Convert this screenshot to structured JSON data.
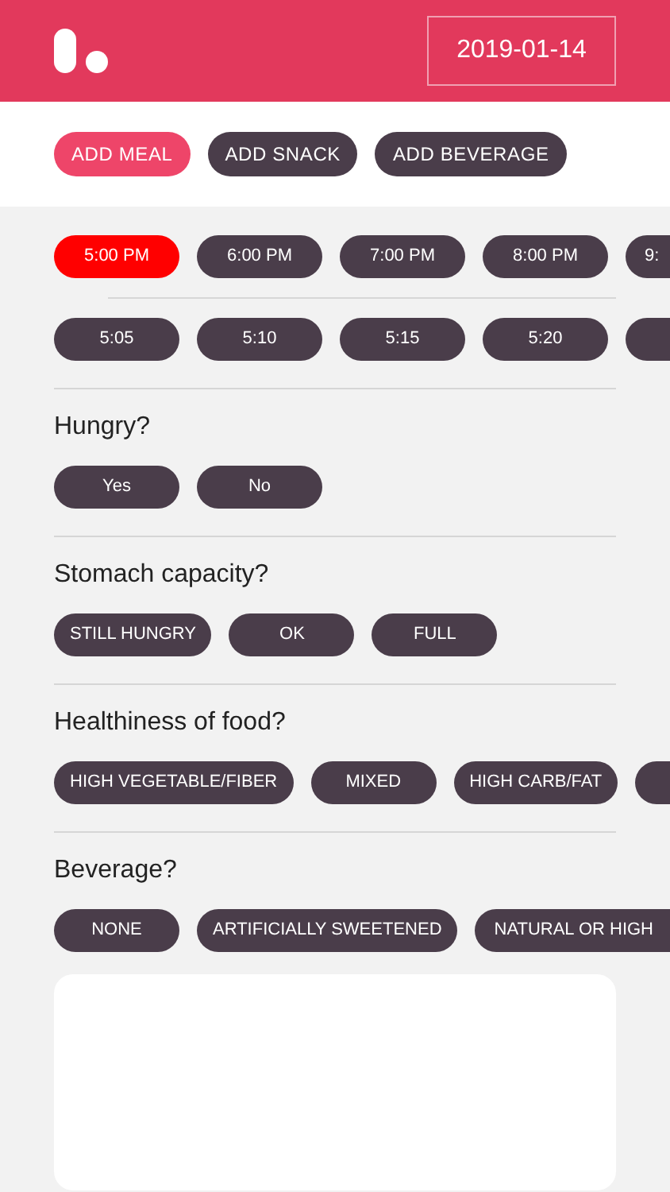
{
  "header": {
    "date": "2019-01-14"
  },
  "meal_types": [
    {
      "label": "ADD MEAL",
      "selected": true
    },
    {
      "label": "ADD SNACK",
      "selected": false
    },
    {
      "label": "ADD BEVERAGE",
      "selected": false
    }
  ],
  "hours": [
    {
      "label": "5:00 PM",
      "selected": true,
      "kind": "full"
    },
    {
      "label": "6:00 PM",
      "selected": false,
      "kind": "full"
    },
    {
      "label": "7:00 PM",
      "selected": false,
      "kind": "full"
    },
    {
      "label": "8:00 PM",
      "selected": false,
      "kind": "full"
    },
    {
      "label": "9:",
      "selected": false,
      "kind": "partial"
    }
  ],
  "minutes": [
    {
      "label": "5:05",
      "selected": false,
      "kind": "full"
    },
    {
      "label": "5:10",
      "selected": false,
      "kind": "full"
    },
    {
      "label": "5:15",
      "selected": false,
      "kind": "full"
    },
    {
      "label": "5:20",
      "selected": false,
      "kind": "full"
    },
    {
      "selected": false,
      "kind": "partial"
    }
  ],
  "questions": [
    {
      "title": "Hungry?",
      "options": [
        {
          "label": "Yes",
          "selected": false,
          "kind": "full"
        },
        {
          "label": "No",
          "selected": false,
          "kind": "full"
        }
      ]
    },
    {
      "title": "Stomach capacity?",
      "options": [
        {
          "label": "STILL HUNGRY",
          "selected": false,
          "kind": "full"
        },
        {
          "label": "OK",
          "selected": false,
          "kind": "full"
        },
        {
          "label": "FULL",
          "selected": false,
          "kind": "full"
        }
      ]
    },
    {
      "title": "Healthiness of food?",
      "options": [
        {
          "label": "HIGH VEGETABLE/FIBER",
          "selected": false,
          "kind": "full"
        },
        {
          "label": "MIXED",
          "selected": false,
          "kind": "full"
        },
        {
          "label": "HIGH CARB/FAT",
          "selected": false,
          "kind": "full"
        },
        {
          "selected": false,
          "kind": "partial"
        }
      ]
    },
    {
      "title": "Beverage?",
      "options": [
        {
          "label": "NONE",
          "selected": false,
          "kind": "full"
        },
        {
          "label": "ARTIFICIALLY SWEETENED",
          "selected": false,
          "kind": "full"
        },
        {
          "label": "NATURAL OR HIGH",
          "selected": false,
          "kind": "partial"
        }
      ]
    }
  ],
  "notes": {
    "kind": "text-area"
  }
}
